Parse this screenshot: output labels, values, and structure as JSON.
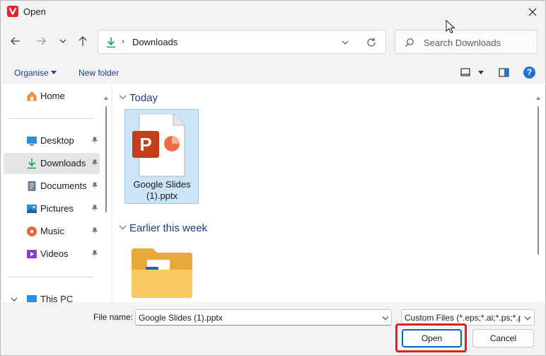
{
  "window": {
    "title": "Open",
    "app_icon": "vivaldi-logo-icon",
    "close_icon": "close-icon"
  },
  "nav": {
    "back_icon": "back-arrow-icon",
    "forward_icon": "forward-arrow-icon",
    "recent_icon": "chevron-down-icon",
    "up_icon": "up-arrow-icon"
  },
  "address": {
    "location_icon": "download-arrow-icon",
    "separator": "›",
    "path": "Downloads",
    "dropdown_icon": "chevron-down-icon",
    "refresh_icon": "refresh-icon"
  },
  "search": {
    "placeholder": "Search Downloads",
    "value": ""
  },
  "toolbar": {
    "organise_label": "Organise",
    "new_folder_label": "New folder",
    "help_label": "?"
  },
  "sidebar": {
    "items": [
      {
        "label": "Home",
        "icon": "home-icon",
        "pinned": false,
        "active": false
      },
      {
        "label": "Desktop",
        "icon": "desktop-icon",
        "pinned": true,
        "active": false
      },
      {
        "label": "Downloads",
        "icon": "download-arrow-icon",
        "pinned": true,
        "active": true
      },
      {
        "label": "Documents",
        "icon": "document-icon",
        "pinned": true,
        "active": false
      },
      {
        "label": "Pictures",
        "icon": "pictures-icon",
        "pinned": true,
        "active": false
      },
      {
        "label": "Music",
        "icon": "music-icon",
        "pinned": true,
        "active": false
      },
      {
        "label": "Videos",
        "icon": "video-icon",
        "pinned": true,
        "active": false
      },
      {
        "label": "This PC",
        "icon": "computer-icon",
        "pinned": false,
        "active": false
      }
    ]
  },
  "content": {
    "groups": [
      {
        "label": "Today",
        "files": [
          {
            "name": "Google Slides (1).pptx",
            "icon": "powerpoint-file-icon",
            "selected": true
          }
        ]
      },
      {
        "label": "Earlier this week",
        "files": [
          {
            "name": "",
            "icon": "word-folder-icon",
            "selected": false
          }
        ]
      }
    ]
  },
  "footer": {
    "file_name_label": "File name:",
    "file_name_value": "Google Slides (1).pptx",
    "file_type_value": "Custom Files (*.eps;*.ai;*.ps;*.pdf)",
    "open_label": "Open",
    "cancel_label": "Cancel",
    "highlight_color": "#e02020",
    "accent_color": "#0067c0"
  }
}
